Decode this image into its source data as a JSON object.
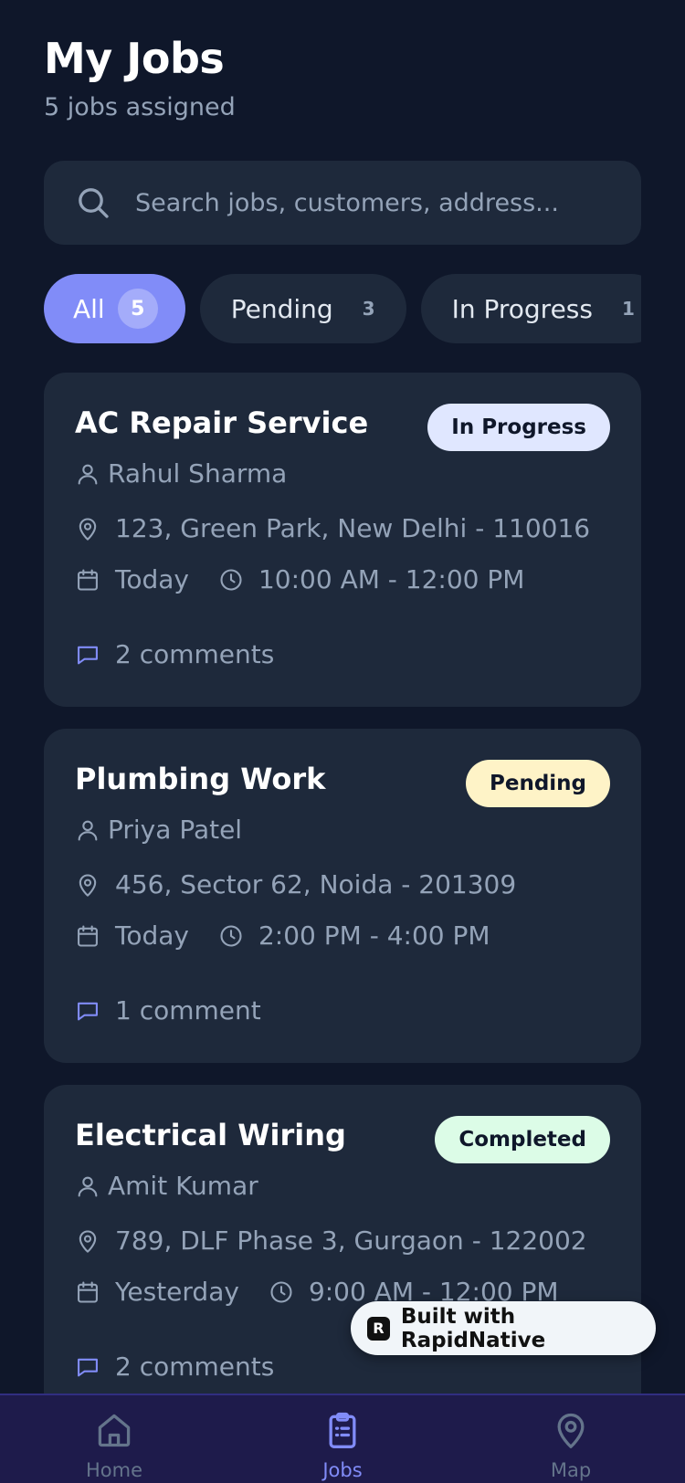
{
  "header": {
    "title": "My Jobs",
    "subtitle": "5 jobs assigned"
  },
  "search": {
    "placeholder": "Search jobs, customers, address..."
  },
  "filters": [
    {
      "label": "All",
      "count": "5",
      "active": true
    },
    {
      "label": "Pending",
      "count": "3",
      "active": false
    },
    {
      "label": "In Progress",
      "count": "1",
      "active": false
    }
  ],
  "jobs": [
    {
      "title": "AC Repair Service",
      "status": "In Progress",
      "status_color": "#e0e7ff",
      "customer": "Rahul Sharma",
      "address": "123, Green Park, New Delhi - 110016",
      "date": "Today",
      "time": "10:00 AM - 12:00 PM",
      "comments": "2 comments"
    },
    {
      "title": "Plumbing Work",
      "status": "Pending",
      "status_color": "#fef3c7",
      "customer": "Priya Patel",
      "address": "456, Sector 62, Noida - 201309",
      "date": "Today",
      "time": "2:00 PM - 4:00 PM",
      "comments": "1 comment"
    },
    {
      "title": "Electrical Wiring",
      "status": "Completed",
      "status_color": "#dcfce7",
      "customer": "Amit Kumar",
      "address": "789, DLF Phase 3, Gurgaon - 122002",
      "date": "Yesterday",
      "time": "9:00 AM - 12:00 PM",
      "comments": "2 comments"
    }
  ],
  "badge": {
    "text": "Built with RapidNative",
    "logo_letter": "R"
  },
  "tabbar": [
    {
      "label": "Home",
      "icon": "home-icon",
      "active": false
    },
    {
      "label": "Jobs",
      "icon": "clipboard-list-icon",
      "active": true
    },
    {
      "label": "Map",
      "icon": "map-pin-icon",
      "active": false
    }
  ],
  "colors": {
    "background": "#0f172a",
    "card": "#1e293b",
    "accent": "#818cf8",
    "muted_text": "#94a3b8",
    "tabbar": "#1e1b4b"
  }
}
